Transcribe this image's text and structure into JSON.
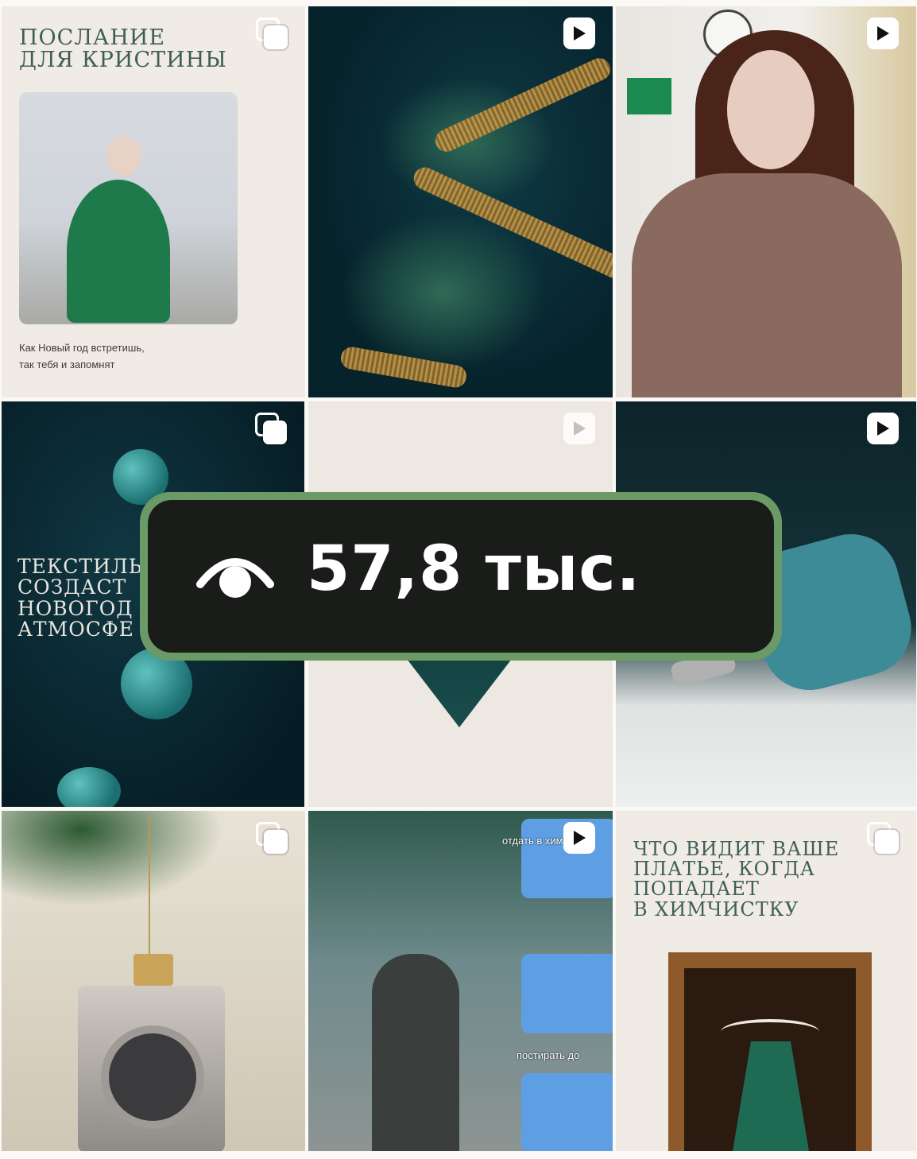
{
  "grid": {
    "tiles": [
      {
        "type": "album",
        "title_lines": [
          "ПОСЛАНИЕ",
          "ДЛЯ КРИСТИНЫ"
        ],
        "caption_lines": [
          "Как Новый год встретишь,",
          "так тебя и запомнят"
        ]
      },
      {
        "type": "reel"
      },
      {
        "type": "reel"
      },
      {
        "type": "album",
        "title_lines": [
          "ТЕКСТИЛЬ",
          "СОЗДАСТ",
          "НОВОГОД",
          "АТМОСФЕ"
        ]
      },
      {
        "type": "reel"
      },
      {
        "type": "reel"
      },
      {
        "type": "album"
      },
      {
        "type": "reel",
        "labels": [
          "отдать в химчис",
          "постирать до"
        ]
      },
      {
        "type": "album",
        "title_lines": [
          "ЧТО ВИДИТ ВАШЕ",
          "ПЛАТЬЕ, КОГДА",
          "ПОПАДАЕТ",
          "В ХИМЧИСТКУ"
        ]
      }
    ]
  },
  "overlay": {
    "views_value": "57,8 тыс.",
    "icon": "eye-icon",
    "border_color": "#6c9a67"
  },
  "colors": {
    "title_text": "#3e5f58",
    "overlay_bg": "#121212"
  }
}
